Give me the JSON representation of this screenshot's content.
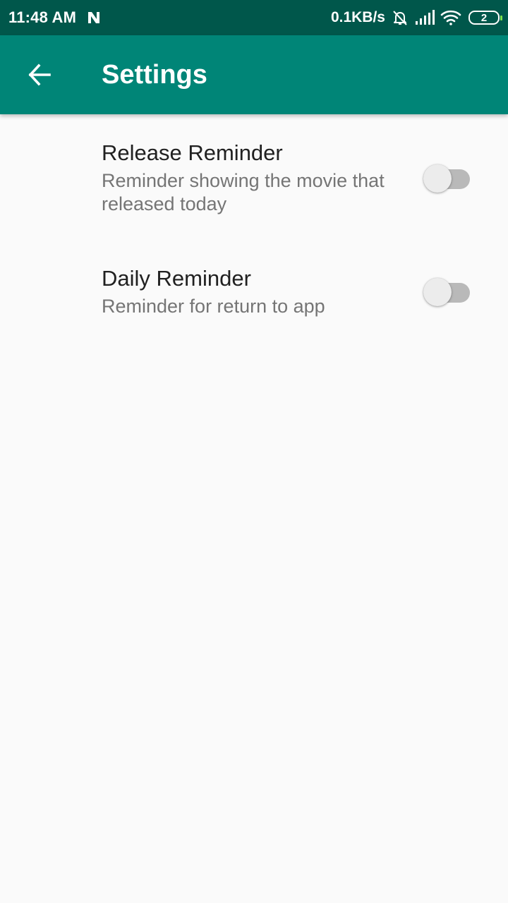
{
  "status_bar": {
    "time": "11:48 AM",
    "notification_icon": "n-letter-icon",
    "network_speed": "0.1KB/s",
    "icons": [
      "alarm-off-icon",
      "cellular-signal-icon",
      "wifi-icon"
    ],
    "battery_level": "2",
    "battery_accent_color": "#7ee04a"
  },
  "app_bar": {
    "back_icon": "arrow-left-icon",
    "title": "Settings",
    "color": "#008577"
  },
  "settings": [
    {
      "title": "Release Reminder",
      "summary": "Reminder showing the movie that released today",
      "enabled": false
    },
    {
      "title": "Daily Reminder",
      "summary": "Reminder for return to app",
      "enabled": false
    }
  ]
}
